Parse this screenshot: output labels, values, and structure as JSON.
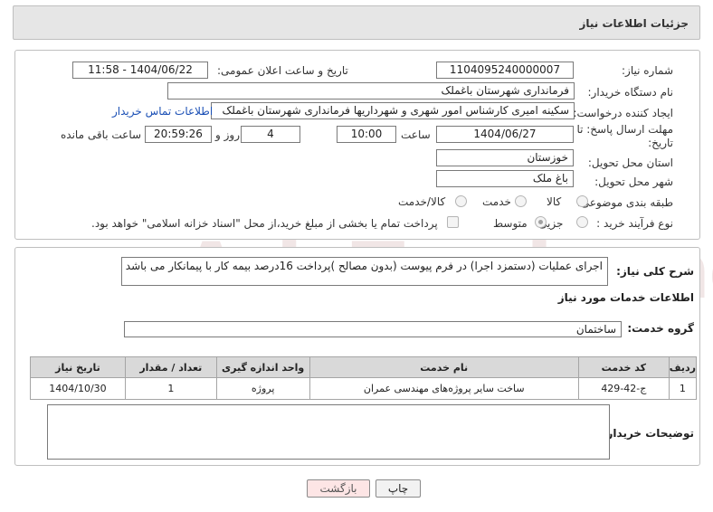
{
  "header": {
    "title": "جزئیات اطلاعات نیاز"
  },
  "fields": {
    "need_number_label": "شماره نیاز:",
    "need_number": "1104095240000007",
    "announce_label": "تاریخ و ساعت اعلان عمومی:",
    "announce_value": "1404/06/22 - 11:58",
    "buyer_org_label": "نام دستگاه خریدار:",
    "buyer_org": "فرمانداری شهرستان باغملک",
    "requester_label": "ایجاد کننده درخواست:",
    "requester": "سکینه امیری کارشناس امور  شهری  و شهرداریها فرمانداری شهرستان باغملک",
    "contact_link": "اطلاعات تماس خریدار",
    "deadline_label_1": "مهلت ارسال پاسخ: تا",
    "deadline_label_2": "تاریخ:",
    "deadline_date": "1404/06/27",
    "time_label": "ساعت",
    "deadline_time": "10:00",
    "days_value": "4",
    "days_label": "روز و",
    "remaining_time": "20:59:26",
    "remaining_label": "ساعت باقی مانده",
    "province_label": "استان محل تحویل:",
    "province": "خوزستان",
    "city_label": "شهر محل تحویل:",
    "city": "باغ ملک",
    "category_label": "طبقه بندی موضوعی:",
    "category_options": [
      "کالا",
      "خدمت",
      "کالا/خدمت"
    ],
    "process_label": "نوع فرآیند خرید :",
    "process_options": [
      "جزیی",
      "متوسط"
    ],
    "treasury_note": "پرداخت تمام یا بخشی از مبلغ خرید،از محل \"اسناد خزانه اسلامی\" خواهد بود."
  },
  "description": {
    "label": "شرح کلی نیاز:",
    "text": "اجرای  عملیات  (دستمزد اجرا)  در فرم  پیوست  (بدون مصالح )پرداخت 16درصد بیمه کار با  پیمانکار  می باشد"
  },
  "services": {
    "section_title": "اطلاعات خدمات مورد نیاز",
    "group_label": "گروه خدمت:",
    "group_value": "ساختمان",
    "columns": [
      "ردیف",
      "کد خدمت",
      "نام خدمت",
      "واحد اندازه گیری",
      "تعداد / مقدار",
      "تاریخ نیاز"
    ],
    "rows": [
      {
        "row": "1",
        "code": "ج-42-429",
        "name": "ساخت سایر پروژه‌های مهندسی عمران",
        "unit": "پروژه",
        "qty": "1",
        "date": "1404/10/30"
      }
    ]
  },
  "buyer_notes": {
    "label": "توضیحات خریدار:",
    "value": ""
  },
  "buttons": {
    "print": "چاپ",
    "back": "بازگشت"
  },
  "watermark": "AriaTender.neT"
}
